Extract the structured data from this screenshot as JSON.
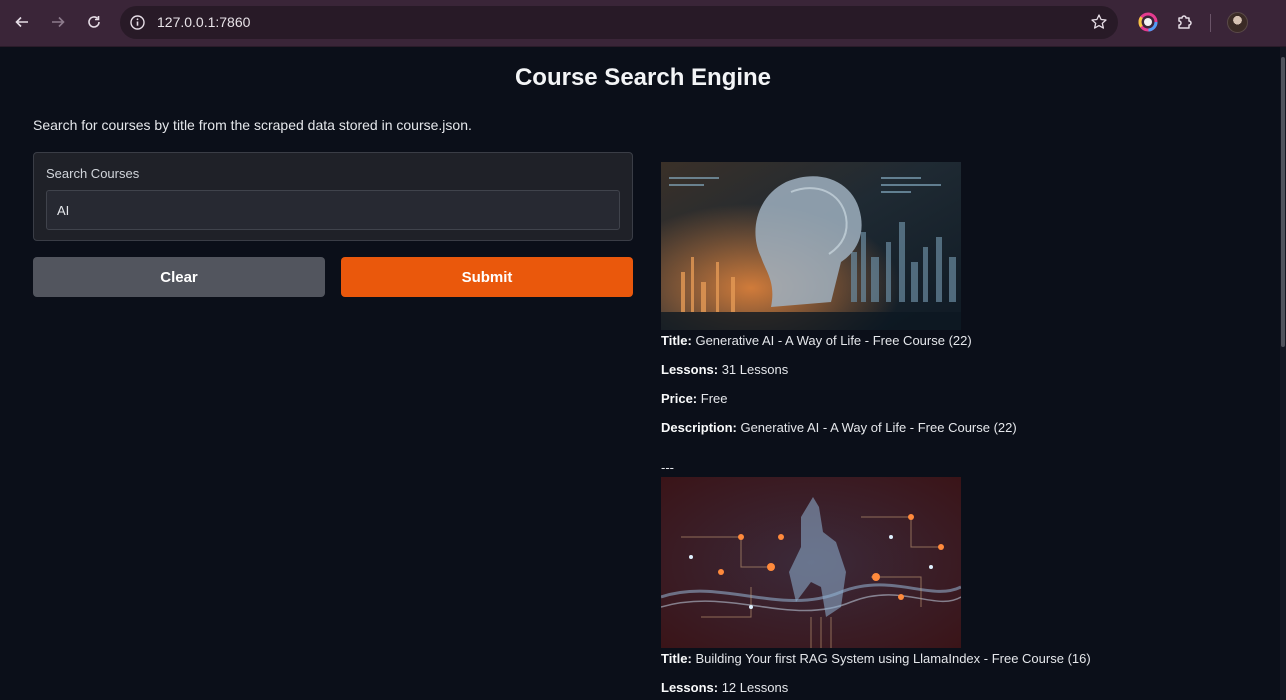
{
  "browser": {
    "url": "127.0.0.1:7860",
    "icons": [
      "back-icon",
      "forward-icon",
      "reload-icon",
      "site-info-icon",
      "bookmark-star-icon",
      "color-extension-icon",
      "extensions-puzzle-icon",
      "profile-avatar"
    ]
  },
  "app": {
    "title": "Course Search Engine",
    "description": "Search for courses by title from the scraped data stored in course.json.",
    "search": {
      "label": "Search Courses",
      "value": "AI"
    },
    "buttons": {
      "clear": "Clear",
      "submit": "Submit"
    },
    "accent_color": "#ea580c"
  },
  "results": [
    {
      "title_label": "Title:",
      "title": "Generative AI - A Way of Life - Free Course (22)",
      "lessons_label": "Lessons:",
      "lessons": "31 Lessons",
      "price_label": "Price:",
      "price": "Free",
      "description_label": "Description:",
      "description": "Generative AI - A Way of Life - Free Course (22)",
      "separator": "---"
    },
    {
      "title_label": "Title:",
      "title": "Building Your first RAG System using LlamaIndex - Free Course (16)",
      "lessons_label": "Lessons:",
      "lessons": "12 Lessons"
    }
  ]
}
